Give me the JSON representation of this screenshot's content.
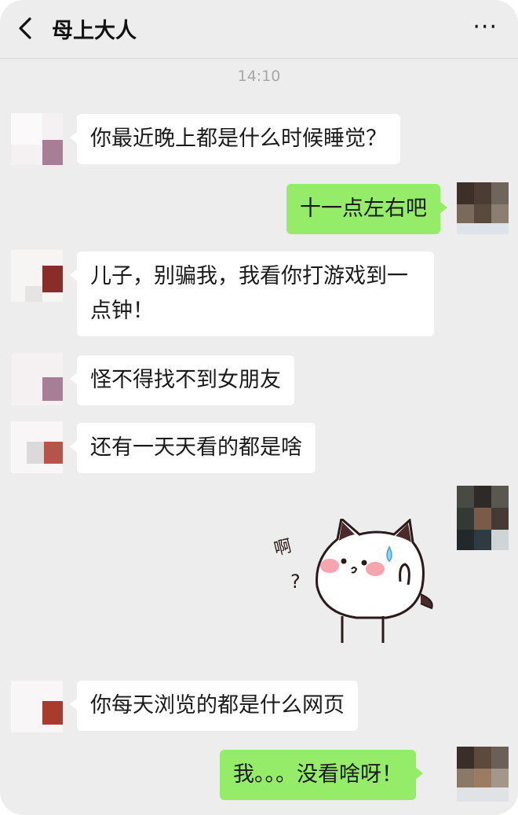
{
  "header": {
    "back_icon": "chevron-left-icon",
    "title": "母上大人",
    "more_label": "···"
  },
  "timestamp": "14:10",
  "messages": [
    {
      "side": "in",
      "text": "你最近晚上都是什么时候睡觉？"
    },
    {
      "side": "out",
      "text": "十一点左右吧"
    },
    {
      "side": "in",
      "text": "儿子，别骗我，我看你打游戏到一点钟！"
    },
    {
      "side": "in",
      "text": "怪不得找不到女朋友"
    },
    {
      "side": "in",
      "text": "还有一天天看的都是啥"
    },
    {
      "side": "out",
      "type": "sticker",
      "sticker_text": "啊",
      "sticker_mark": "?"
    },
    {
      "side": "in",
      "text": "你每天浏览的都是什么网页"
    },
    {
      "side": "out",
      "text": "我。。。没看啥呀！"
    }
  ]
}
